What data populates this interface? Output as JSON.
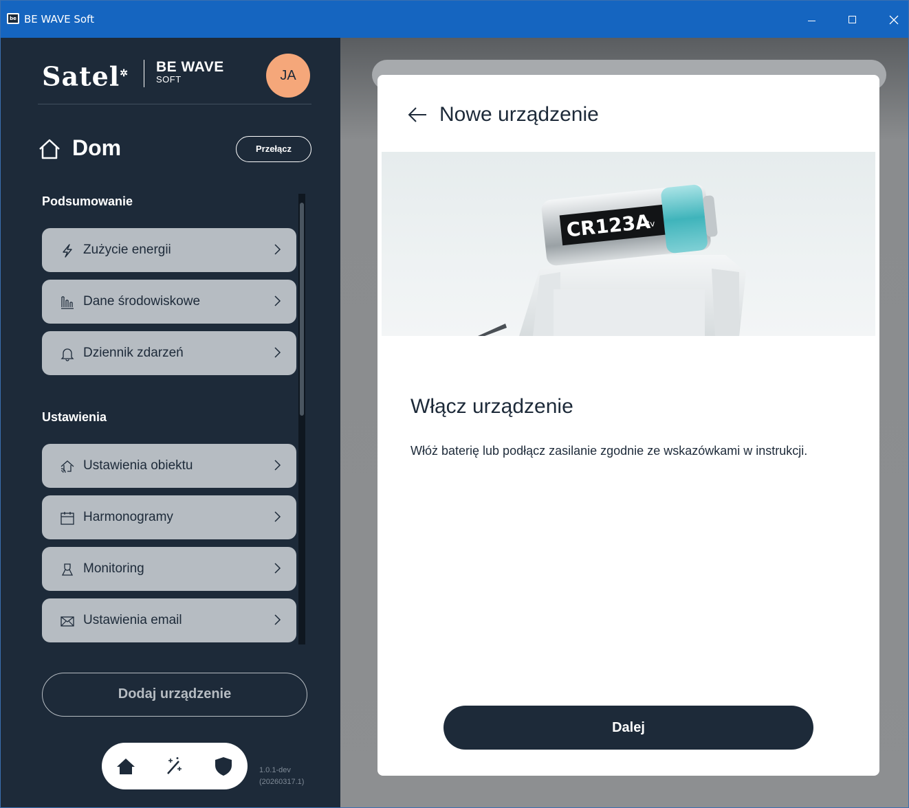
{
  "window": {
    "title": "BE WAVE Soft",
    "app_icon_text": "be"
  },
  "sidebar": {
    "logo_text": "Satel",
    "brand_line1": "BE WAVE",
    "brand_line2": "SOFT",
    "avatar_initials": "JA",
    "home_title": "Dom",
    "switch_label": "Przełącz",
    "summary_title": "Podsumowanie",
    "summary_items": [
      {
        "label": "Zużycie energii",
        "icon": "lightning-icon"
      },
      {
        "label": "Dane środowiskowe",
        "icon": "environment-chart-icon"
      },
      {
        "label": "Dziennik zdarzeń",
        "icon": "bell-icon"
      }
    ],
    "settings_title": "Ustawienia",
    "settings_items": [
      {
        "label": "Ustawienia obiektu",
        "icon": "house-wifi-icon"
      },
      {
        "label": "Harmonogramy",
        "icon": "calendar-icon"
      },
      {
        "label": "Monitoring",
        "icon": "monitoring-person-icon"
      },
      {
        "label": "Ustawienia email",
        "icon": "envelope-icon"
      }
    ],
    "add_device_label": "Dodaj urządzenie",
    "version_line1": "1.0.1-dev",
    "version_line2": "(20260317.1)",
    "bottom_nav": [
      "home-icon",
      "magic-wand-icon",
      "shield-icon"
    ]
  },
  "modal": {
    "title": "Nowe urządzenie",
    "battery_label": "CR123A",
    "battery_voltage": "3v",
    "step_title": "Włącz urządzenie",
    "step_description": "Włóż baterię lub podłącz zasilanie zgodnie ze wskazówkami w instrukcji.",
    "next_label": "Dalej"
  },
  "colors": {
    "sidebar_bg": "#1d2a39",
    "menu_item_bg": "#b6bcc2",
    "avatar_bg": "#f5a77a",
    "titlebar_bg": "#1565c0",
    "primary_button": "#1d2a39"
  }
}
